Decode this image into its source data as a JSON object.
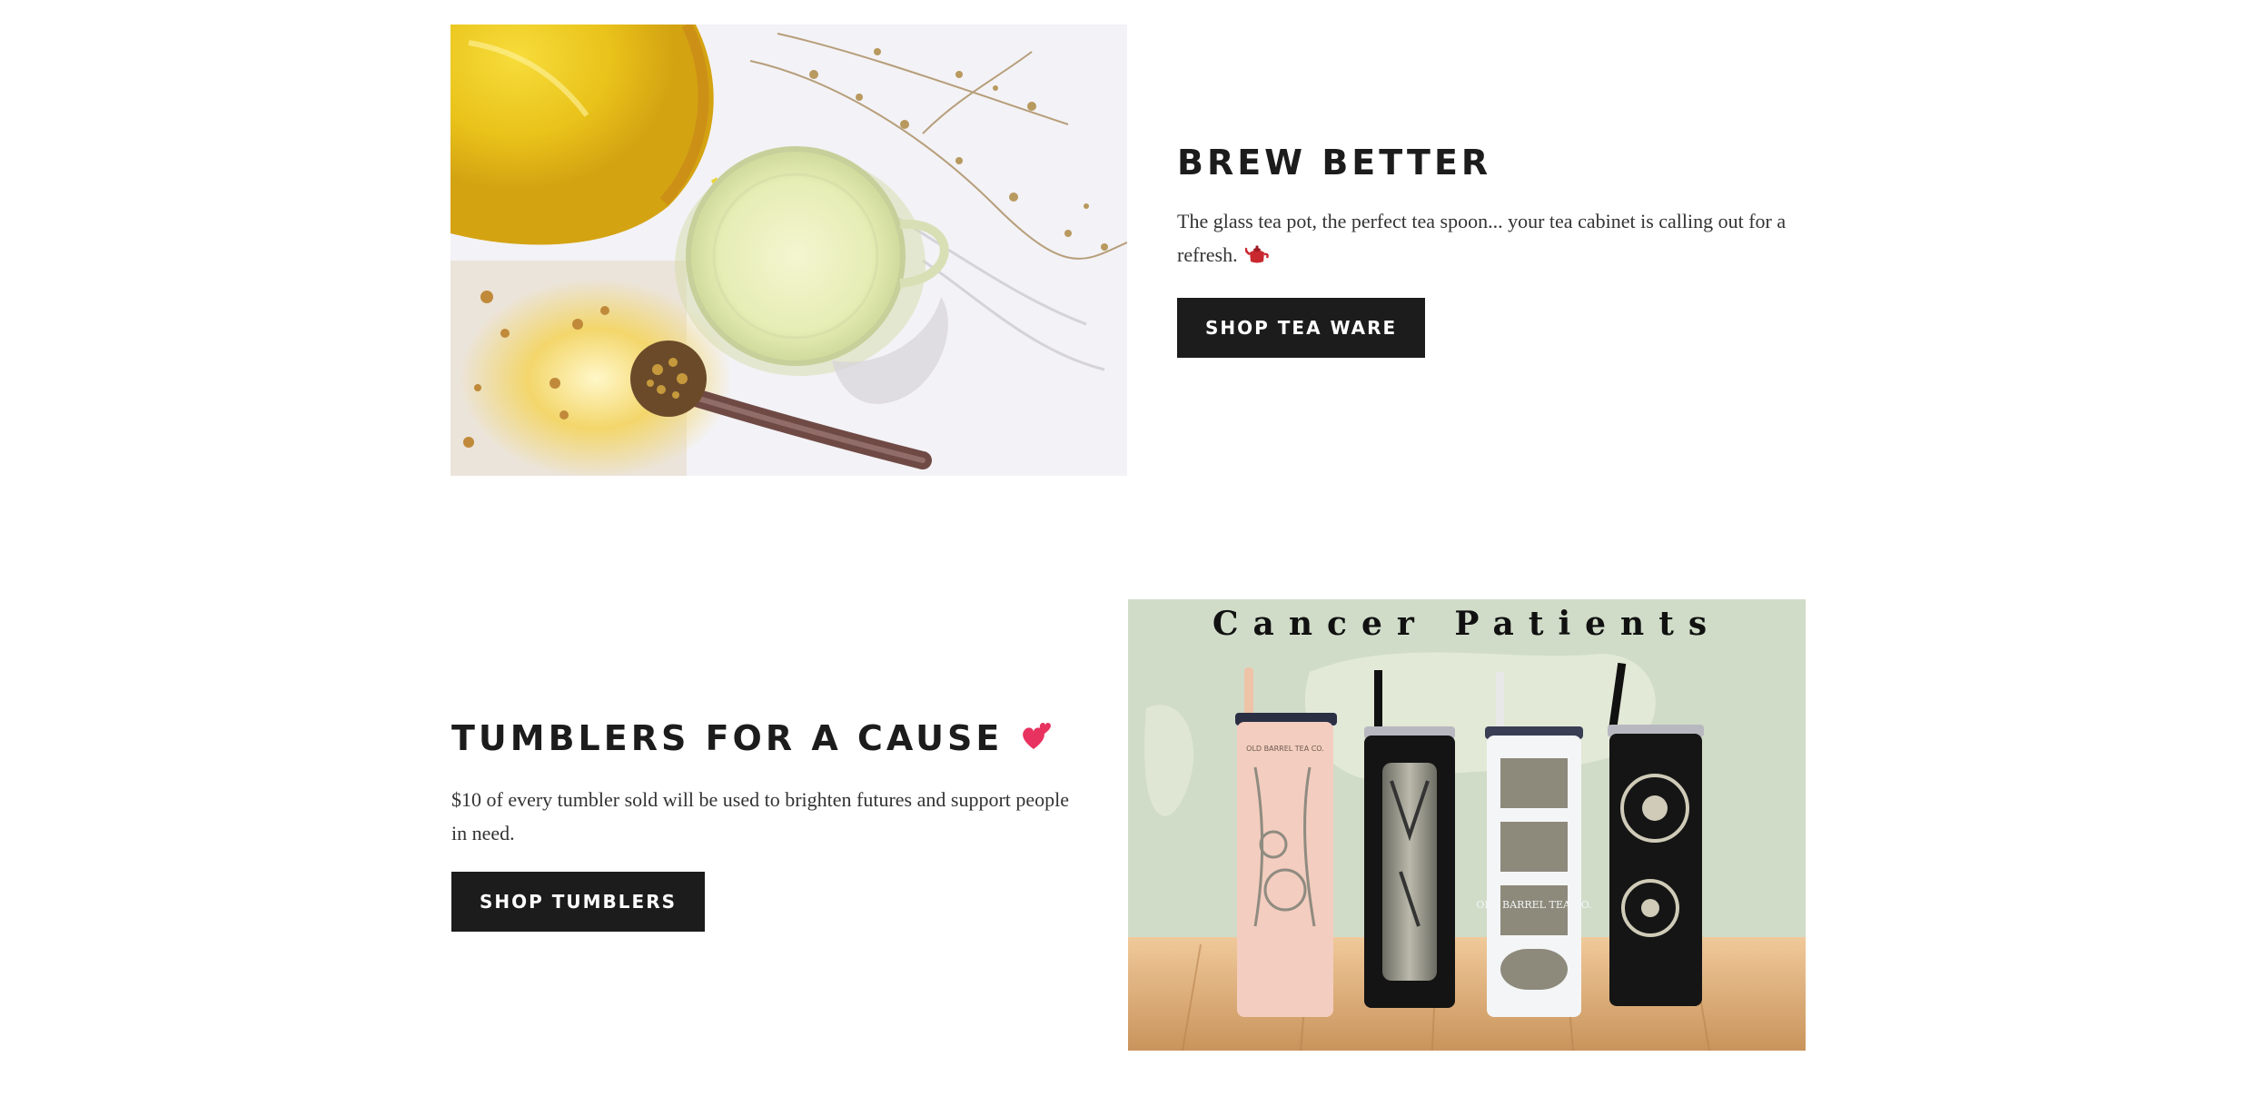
{
  "colors": {
    "text_dark": "#1c1c1c",
    "body_text": "#333333",
    "button_bg": "#1c1c1c",
    "button_text": "#ffffff",
    "background": "#ffffff"
  },
  "sections": [
    {
      "heading": "BREW BETTER",
      "body": "The glass tea pot, the perfect tea spoon... your tea cabinet is calling out for a refresh.",
      "emoji_icon": "teapot-icon",
      "button_label": "SHOP TEA WARE",
      "image_icon": "tea-pouring-photo"
    },
    {
      "heading": "TUMBLERS FOR A CAUSE",
      "body": "$10 of every tumbler sold will be used to brighten futures and support people in need.",
      "emoji_icon": "two-hearts-icon",
      "button_label": "SHOP TUMBLERS",
      "image_icon": "tumblers-photo",
      "image_overlay_text": "Cancer Patients",
      "tumbler_label_1": "OLD BARREL TEA CO.",
      "tumbler_label_2": "OLD BARREL TEA CO."
    }
  ]
}
